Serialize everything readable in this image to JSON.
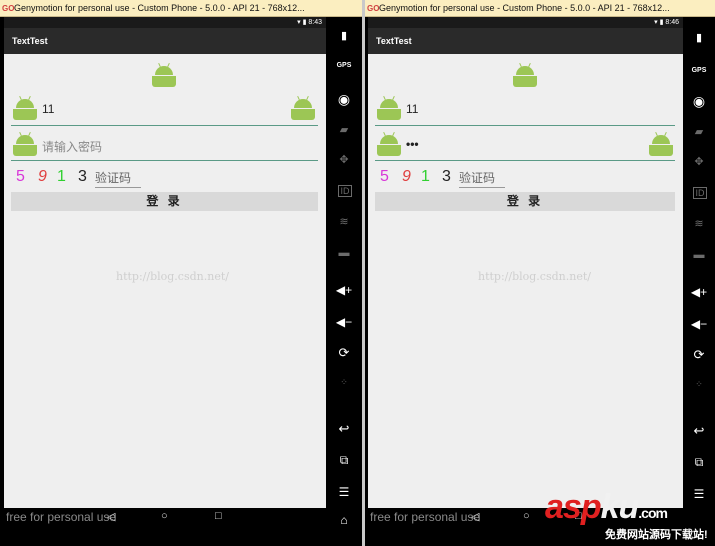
{
  "windows": [
    {
      "title": "Genymotion for personal use - Custom Phone - 5.0.0 - API 21 - 768x12...",
      "time": "8:43",
      "app_title": "TextTest",
      "username": "11",
      "password_hint": "请输入密码",
      "password_value": "",
      "captcha_digits": [
        "5",
        "9",
        "1",
        "3"
      ],
      "captcha_hint": "验证码",
      "login_label": "登 录",
      "watermark": "http://blog.csdn.net/",
      "footer": "free for personal use"
    },
    {
      "title": "Genymotion for personal use - Custom Phone - 5.0.0 - API 21 - 768x12...",
      "time": "8:46",
      "app_title": "TextTest",
      "username": "11",
      "password_hint": "",
      "password_value": "•••",
      "captcha_digits": [
        "5",
        "9",
        "1",
        "3"
      ],
      "captcha_hint": "验证码",
      "login_label": "登 录",
      "watermark": "http://blog.csdn.net/",
      "footer": "free for personal use"
    }
  ],
  "side_icons": [
    "battery-icon",
    "gps-icon",
    "camera-icon",
    "video-icon",
    "dpad-icon",
    "id-icon",
    "rss-icon",
    "sms-icon",
    "volume-up-icon",
    "volume-down-icon",
    "rotate-icon",
    "scale-icon",
    "back-icon",
    "recents-icon",
    "menu-icon",
    "home-icon"
  ],
  "side_labels": {
    "gps": "GPS",
    "id": "ID"
  },
  "logo": {
    "asp": "asp",
    "ku": "ku",
    "com": ".com",
    "sub": "免费网站源码下载站!"
  },
  "colors": {
    "digit1": "#d838d8",
    "digit2": "#e04040",
    "digit3": "#30d030",
    "digit4": "#222222",
    "android": "#9cc655"
  }
}
